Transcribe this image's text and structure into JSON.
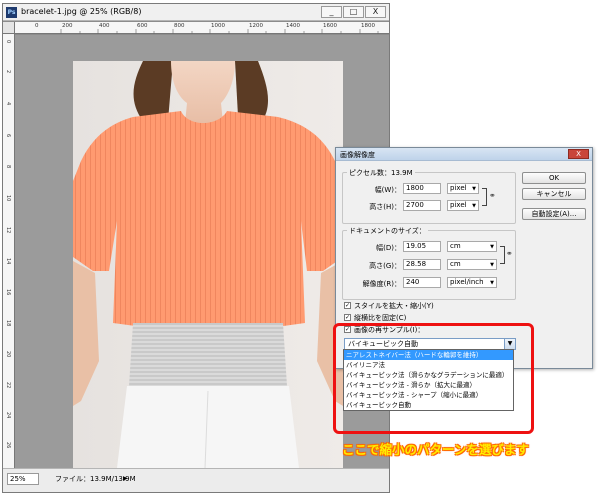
{
  "document_window": {
    "title": "bracelet-1.jpg @ 25% (RGB/8)",
    "ps_icon": "Ps",
    "minimize_glyph": "_",
    "maximize_glyph": "□",
    "close_glyph": "X",
    "ruler_top_labels": [
      "0",
      "200",
      "400",
      "600",
      "800",
      "1000",
      "1200",
      "1400",
      "1600",
      "1800"
    ],
    "ruler_left_labels": [
      "0",
      "2",
      "4",
      "6",
      "8",
      "10",
      "12",
      "14",
      "16",
      "18",
      "20",
      "22",
      "24",
      "26"
    ],
    "status": {
      "zoom": "25%",
      "file_info": "ファイル：13.9M/13.9M",
      "arrow": "▶"
    }
  },
  "dialog": {
    "title": "画像解像度",
    "close_glyph": "X",
    "pixel_group": {
      "legend": "ピクセル数：13.9M",
      "width_label": "幅(W)：",
      "width_value": "1800",
      "width_unit": "pixel",
      "height_label": "高さ(H)：",
      "height_value": "2700",
      "height_unit": "pixel"
    },
    "doc_group": {
      "legend": "ドキュメントのサイズ：",
      "width_label": "幅(D)：",
      "width_value": "19.05",
      "width_unit": "cm",
      "height_label": "高さ(G)：",
      "height_value": "28.58",
      "height_unit": "cm",
      "resolution_label": "解像度(R)：",
      "resolution_value": "240",
      "resolution_unit": "pixel/inch"
    },
    "checkboxes": [
      {
        "label": "スタイルを拡大・縮小(Y)",
        "checked": true
      },
      {
        "label": "縦横比を固定(C)",
        "checked": true
      },
      {
        "label": "画像の再サンプル(I)：",
        "checked": true
      }
    ],
    "resample_value": "バイキュービック自動",
    "buttons": {
      "ok": "OK",
      "cancel": "キャンセル",
      "auto": "自動設定(A)..."
    }
  },
  "dropdown": {
    "options": [
      "ニアレストネイバー法（ハードな輪郭を維持）",
      "バイリニア法",
      "バイキュービック法（滑らかなグラデーションに最適）",
      "バイキュービック法 - 滑らか（拡大に最適）",
      "バイキュービック法 - シャープ（縮小に最適）",
      "バイキュービック自動"
    ],
    "highlighted_index": 0
  },
  "caption": "ここで縮小のパターンを選びます",
  "colors": {
    "shirt": "#ff9a70",
    "highlight": "#3399ff",
    "red_box": "#ee1111",
    "caption_fill": "#ffec00"
  }
}
